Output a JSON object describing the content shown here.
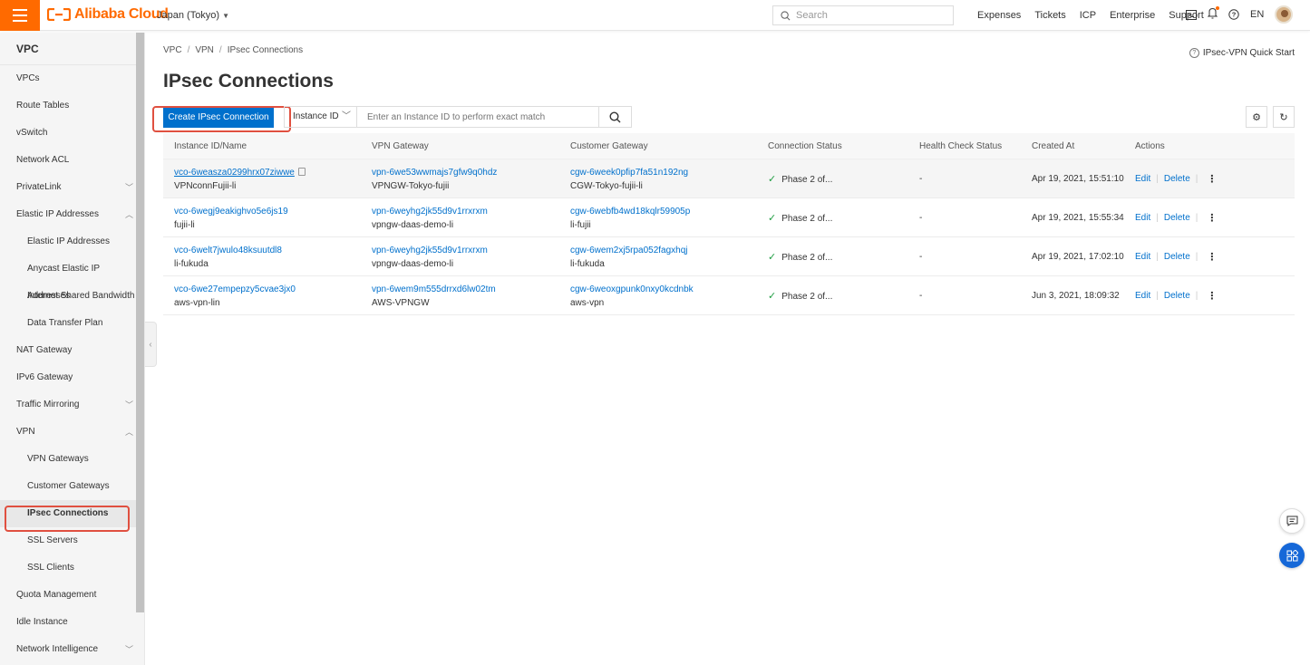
{
  "header": {
    "brand": "Alibaba Cloud",
    "region": "Japan (Tokyo)",
    "search_placeholder": "Search",
    "links": [
      "Expenses",
      "Tickets",
      "ICP",
      "Enterprise",
      "Support"
    ],
    "language": "EN",
    "accent_color": "#ff6a00"
  },
  "sidebar": {
    "title": "VPC",
    "items": [
      {
        "label": "VPCs"
      },
      {
        "label": "Route Tables"
      },
      {
        "label": "vSwitch"
      },
      {
        "label": "Network ACL"
      },
      {
        "label": "PrivateLink"
      },
      {
        "label": "Elastic IP Addresses"
      },
      {
        "label": "Elastic IP Addresses"
      },
      {
        "label": "Anycast Elastic IP Addresses"
      },
      {
        "label": "Internet Shared Bandwidth"
      },
      {
        "label": "Data Transfer Plan"
      },
      {
        "label": "NAT Gateway"
      },
      {
        "label": "IPv6 Gateway"
      },
      {
        "label": "Traffic Mirroring"
      },
      {
        "label": "VPN"
      },
      {
        "label": "VPN Gateways"
      },
      {
        "label": "Customer Gateways"
      },
      {
        "label": "IPsec Connections"
      },
      {
        "label": "SSL Servers"
      },
      {
        "label": "SSL Clients"
      },
      {
        "label": "Quota Management"
      },
      {
        "label": "Idle Instance"
      },
      {
        "label": "Network Intelligence"
      }
    ]
  },
  "breadcrumb": [
    "VPC",
    "VPN",
    "IPsec Connections"
  ],
  "quick_start": "IPsec-VPN Quick Start",
  "page_title": "IPsec Connections",
  "toolbar": {
    "create_label": "Create IPsec Connection",
    "filter_type": "Instance ID",
    "filter_placeholder": "Enter an Instance ID to perform exact match"
  },
  "table": {
    "headers": [
      "Instance ID/Name",
      "VPN Gateway",
      "Customer Gateway",
      "Connection Status",
      "Health Check Status",
      "Created At",
      "Actions"
    ],
    "rows": [
      {
        "id": "vco-6weasza0299hrx07ziwwe",
        "name": "VPNconnFujii-li",
        "vpn_id": "vpn-6we53wwmajs7gfw9q0hdz",
        "vpn_name": "VPNGW-Tokyo-fujii",
        "cgw_id": "cgw-6week0pfip7fa51n192ng",
        "cgw_name": "CGW-Tokyo-fujii-li",
        "status": "Phase 2 of...",
        "health": "-",
        "created": "Apr 19, 2021, 15:51:10",
        "edit": "Edit",
        "delete": "Delete"
      },
      {
        "id": "vco-6wegj9eakighvo5e6js19",
        "name": "fujii-li",
        "vpn_id": "vpn-6weyhg2jk55d9v1rrxrxm",
        "vpn_name": "vpngw-daas-demo-li",
        "cgw_id": "cgw-6webfb4wd18kqlr59905p",
        "cgw_name": "li-fujii",
        "status": "Phase 2 of...",
        "health": "-",
        "created": "Apr 19, 2021, 15:55:34",
        "edit": "Edit",
        "delete": "Delete"
      },
      {
        "id": "vco-6welt7jwulo48ksuutdl8",
        "name": "li-fukuda",
        "vpn_id": "vpn-6weyhg2jk55d9v1rrxrxm",
        "vpn_name": "vpngw-daas-demo-li",
        "cgw_id": "cgw-6wem2xj5rpa052fagxhqj",
        "cgw_name": "li-fukuda",
        "status": "Phase 2 of...",
        "health": "-",
        "created": "Apr 19, 2021, 17:02:10",
        "edit": "Edit",
        "delete": "Delete"
      },
      {
        "id": "vco-6we27empepzy5cvae3jx0",
        "name": "aws-vpn-lin",
        "vpn_id": "vpn-6wem9m555drrxd6lw02tm",
        "vpn_name": "AWS-VPNGW",
        "cgw_id": "cgw-6weoxgpunk0nxy0kcdnbk",
        "cgw_name": "aws-vpn",
        "status": "Phase 2 of...",
        "health": "-",
        "created": "Jun 3, 2021, 18:09:32",
        "edit": "Edit",
        "delete": "Delete"
      }
    ]
  }
}
